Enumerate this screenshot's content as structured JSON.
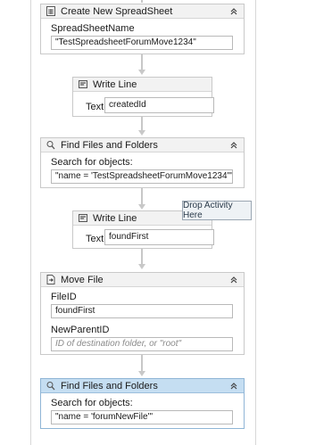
{
  "activities": {
    "create_spreadsheet": {
      "title": "Create New SpreadSheet",
      "field_label": "SpreadSheetName",
      "field_value": "\"TestSpreadsheetForumMove1234\""
    },
    "write_line_1": {
      "title": "Write Line",
      "text_label": "Text",
      "text_value": "createdId"
    },
    "find_files_1": {
      "title": "Find Files and Folders",
      "field_label": "Search for objects:",
      "field_value": "\"name = 'TestSpreadsheetForumMove1234'\""
    },
    "write_line_2": {
      "title": "Write Line",
      "text_label": "Text",
      "text_value": "foundFirst"
    },
    "move_file": {
      "title": "Move File",
      "fileid_label": "FileID",
      "fileid_value": "foundFirst",
      "parent_label": "NewParentID",
      "parent_placeholder": "ID of destination folder, or \"root\""
    },
    "find_files_2": {
      "title": "Find Files and Folders",
      "field_label": "Search for objects:",
      "field_value": "\"name = 'forumNewFile'\""
    }
  },
  "tooltip": {
    "text": "Drop Activity Here"
  },
  "icons": {
    "sheet": "spreadsheet-icon",
    "write_line": "write-line-icon",
    "find": "find-files-icon",
    "move": "move-file-icon",
    "collapse": "collapse-chevron-icon"
  },
  "colors": {
    "selected_header": "#c5def2",
    "header": "#f2f2f2",
    "border": "#c9c9c9"
  }
}
